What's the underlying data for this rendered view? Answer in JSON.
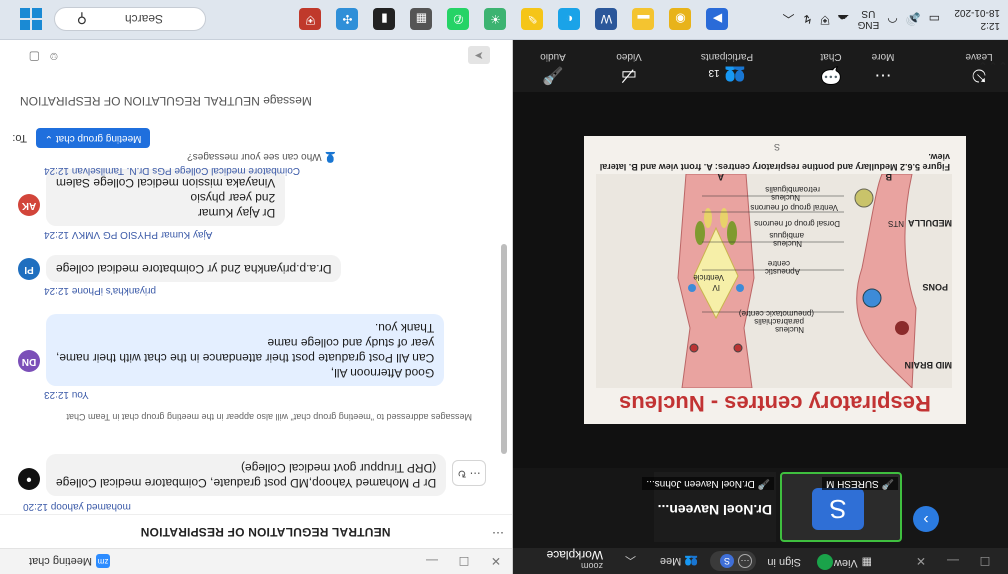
{
  "taskbar": {
    "time": "12:2",
    "date": "18-01-202",
    "lang_top": "ENG",
    "lang_bottom": "US",
    "search_placeholder": "Search",
    "app_icons": [
      "chrome-icon",
      "file-explorer-icon",
      "word-icon",
      "chrome-icon",
      "yellow-app-icon",
      "weather-icon",
      "whatsapp-icon",
      "calculator-icon",
      "sticky-notes-icon",
      "network-app-icon",
      "security-app-icon"
    ]
  },
  "zoom": {
    "brand_top": "zoom",
    "brand_bottom": "Workplace",
    "meeting_label": "Mee",
    "sign_in": "Sign in",
    "view_label": "View",
    "participant_s_initial": "S",
    "participant_s_name": "SURESH M",
    "participant_n_big": "Dr.Noel  Naveen...",
    "participant_n_name": "Dr.Noel Naveen Johns...",
    "toolbar": {
      "audio": "Audio",
      "video": "Video",
      "participants": "Participants",
      "participants_count": "13",
      "chat": "Chat",
      "more": "More",
      "leave": "Leave"
    },
    "slide": {
      "title": "Respiratory centres - Nucleus",
      "caption": "Figure 5.6.2 Medullary and pontine respiratory centres: A. front view and B. lateral view.",
      "page_mark": "S",
      "labels": {
        "a": "A",
        "b": "B",
        "mid_brain": "MID BRAIN",
        "pons": "PONS",
        "medulla": "MEDULLA",
        "nts": "NTS",
        "ventricle": "Ventricle",
        "iv": "IV",
        "nucleus_para": "Nucleus",
        "parabrachialis": "parabrachialis",
        "pneumotaxic": "(pneumotaxic centre)",
        "apneustic": "Apneustic",
        "centre": "centre",
        "nucleus_amb": "Nucleus",
        "ambiguus": "ambiguus",
        "dorsal": "Dorsal group of neurons",
        "ventral": "Ventral group of neurons",
        "nucleus_retro": "Nucleus",
        "retroambigualis": "retroambigualis"
      }
    }
  },
  "chat": {
    "window_title": "Meeting chat",
    "header": "NEUTRAL REGULATION OF RESPIRATION",
    "messages": [
      {
        "sender": "mohamed yahoop 12:20",
        "initials": "",
        "lines": [
          "Dr P Mohamed Yahoop,MD post graduate, Coimbatore medical College",
          "(DRP Tiruppur govt medical College)"
        ]
      },
      {
        "notice": "Messages addressed to \"meeting group chat\" will also appear in the meeting group chat in Team Chat"
      },
      {
        "sender": "You 12:23",
        "initials": "DN",
        "lines": [
          "Good Afternoon All,",
          "Can All Post graduate post their attendance in the chat with their name,",
          "year of study and college name",
          "Thank you."
        ]
      },
      {
        "sender": "priyankha's iPhone 12:24",
        "initials": "PI",
        "lines": [
          "Dr.a.p.priyankha 2nd yr Coimbatore medical college"
        ]
      },
      {
        "sender": "Ajay Kumar PHYSIO PG VMKV 12:24",
        "initials": "AK",
        "lines": [
          "Dr Ajay Kumar",
          "2nd year physio",
          "Vinayaka mission medical College Salem"
        ]
      },
      {
        "sender": "Coimbatore medical College PGs Dr.N. Tamilselvan 12:24",
        "initials": "",
        "lines": []
      }
    ],
    "who_can_see": "Who can see your messages?",
    "to_label": "To:",
    "to_value": "Meeting group chat",
    "input_placeholder": "Message NEUTRAL REGULATION OF RESPIRATION",
    "colors": {
      "accent": "#1f6fdd",
      "bubble": "#e4efff",
      "avatar_dn": "#7b4fb8",
      "avatar_pi": "#1f6fbf",
      "avatar_ak": "#d2453a"
    }
  }
}
